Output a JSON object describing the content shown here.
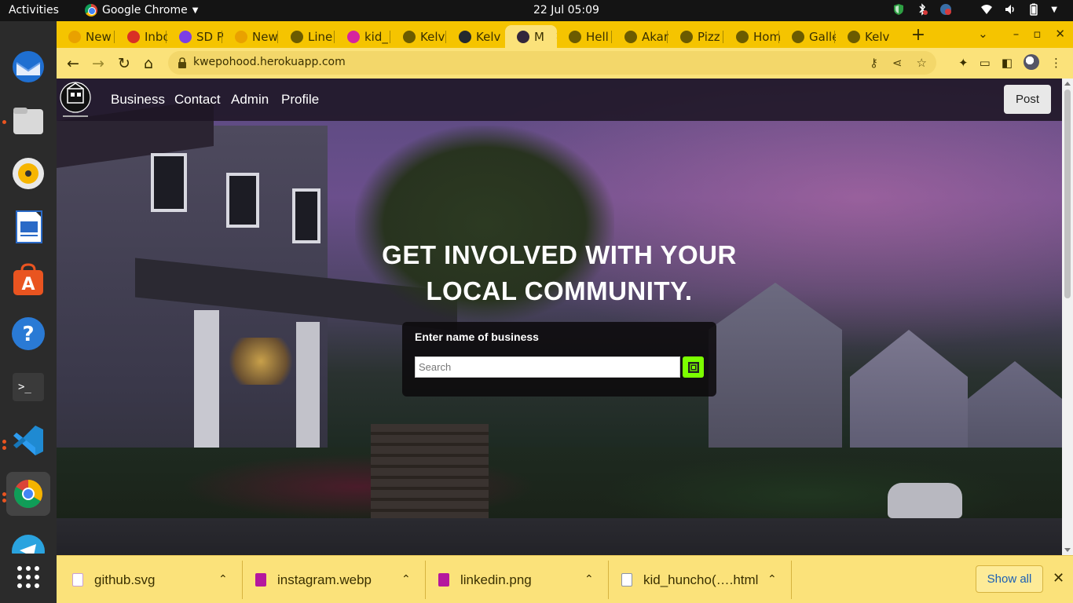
{
  "topbar": {
    "activities": "Activities",
    "app_name": "Google Chrome",
    "clock": "22 Jul  05:09"
  },
  "dock": {
    "apps": [
      "thunderbird-icon",
      "files-icon",
      "rhythmbox-icon",
      "libreoffice-writer-icon",
      "ubuntu-software-icon",
      "help-icon",
      "terminal-icon",
      "vscode-icon",
      "chrome-icon",
      "telegram-icon",
      "show-apps-icon"
    ]
  },
  "tabs": [
    {
      "label": "New",
      "color": "#e9a100"
    },
    {
      "label": "Inbo",
      "color": "#d93025"
    },
    {
      "label": "SD P",
      "color": "#7b3fe4"
    },
    {
      "label": "New",
      "color": "#e9a100"
    },
    {
      "label": "Line",
      "color": "#6b5b00"
    },
    {
      "label": "kid_",
      "color": "#d6249f"
    },
    {
      "label": "Kelv",
      "color": "#6b5b00"
    },
    {
      "label": "Kelv",
      "color": "#24292e"
    },
    {
      "label": "M",
      "color": "#33263b",
      "active": true
    },
    {
      "label": "Hell",
      "color": "#6b5b00"
    },
    {
      "label": "Akar",
      "color": "#6b5b00"
    },
    {
      "label": "Pizz",
      "color": "#6b5b00"
    },
    {
      "label": "Hom",
      "color": "#6b5b00"
    },
    {
      "label": "Galle",
      "color": "#6b5b00"
    },
    {
      "label": "Kelv",
      "color": "#6b5b00"
    }
  ],
  "toolbar": {
    "url": "kwepohood.herokuapp.com"
  },
  "site": {
    "nav_links": [
      "Business",
      "Contact",
      "Admin",
      "Profile"
    ],
    "post_button": "Post",
    "hero_line1": "GET INVOLVED WITH YOUR",
    "hero_line2": "LOCAL COMMUNITY.",
    "search_label": "Enter name of business",
    "search_placeholder": "Search",
    "search_value": ""
  },
  "downloads": {
    "items": [
      {
        "name": "github.svg",
        "color": "#c9a0d6"
      },
      {
        "name": "instagram.webp",
        "color": "#b5179e"
      },
      {
        "name": "linkedin.png",
        "color": "#b5179e"
      },
      {
        "name": "kid_huncho(….html",
        "color": "#8a93a8"
      }
    ],
    "show_all": "Show all"
  }
}
